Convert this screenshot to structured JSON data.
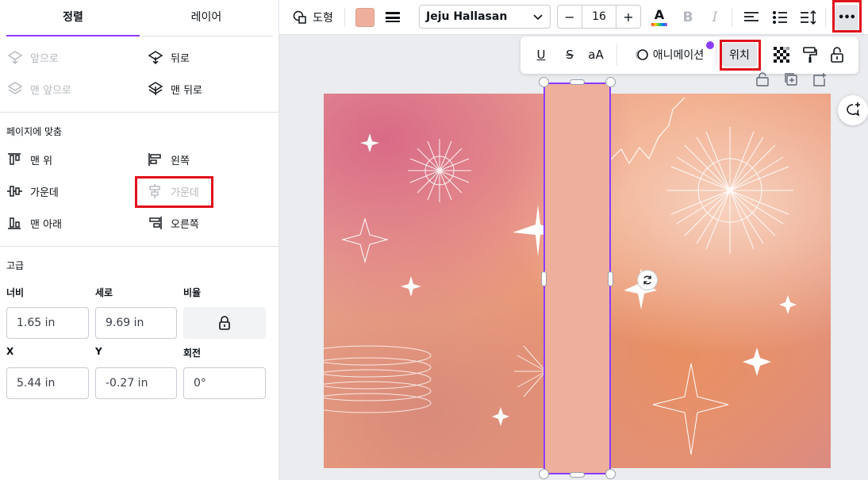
{
  "left_panel": {
    "tabs": [
      {
        "label": "정렬",
        "active": true
      },
      {
        "label": "레이어",
        "active": false
      }
    ],
    "layer_order": {
      "forward": "앞으로",
      "backward": "뒤로",
      "to_front": "맨 앞으로",
      "to_back": "맨 뒤로"
    },
    "align_section_title": "페이지에 맞춤",
    "align": {
      "top": "맨 위",
      "left": "왼쪽",
      "middle": "가운데",
      "center": "가운데",
      "bottom": "맨 아래",
      "right": "오른쪽"
    },
    "advanced_title": "고급",
    "fields": {
      "width_label": "너비",
      "height_label": "세로",
      "ratio_label": "비율",
      "x_label": "X",
      "y_label": "Y",
      "rotation_label": "회전",
      "width_value": "1.65 in",
      "height_value": "9.69 in",
      "x_value": "5.44 in",
      "y_value": "-0.27 in",
      "rotation_value": "0°"
    }
  },
  "toolbar": {
    "shape_label": "도형",
    "fill_color": "#eeb09c",
    "font": "Jeju Hallasan",
    "font_size": "16",
    "minus": "−",
    "plus": "+",
    "text_color_letter": "A",
    "bold": "B",
    "italic": "I",
    "more": "•••"
  },
  "toolbar2": {
    "underline": "U",
    "strikethrough": "S",
    "case": "aA",
    "animate_label": "애니메이션",
    "position_label": "위치"
  },
  "colors": {
    "accent": "#8b3dff",
    "highlight": "#e0111a",
    "canvas_base": "#f1a57f"
  }
}
